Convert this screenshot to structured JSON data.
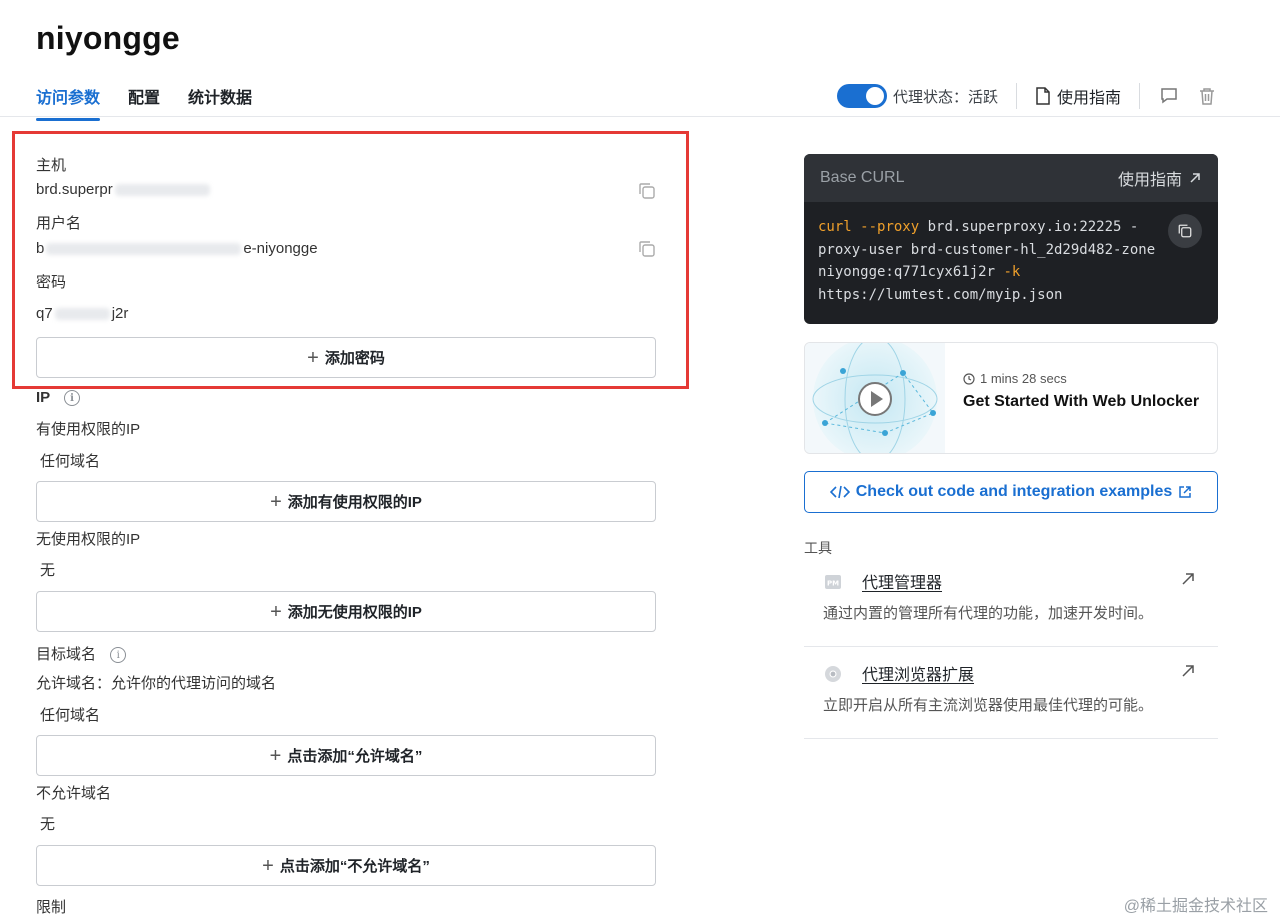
{
  "header": {
    "title": "niyongge",
    "tabs": [
      {
        "label": "访问参数",
        "active": true
      },
      {
        "label": "配置",
        "active": false
      },
      {
        "label": "统计数据",
        "active": false
      }
    ],
    "proxy_status_label": "代理状态：活跃",
    "guide_label": "使用指南",
    "accent_color": "#1a6fd1"
  },
  "credentials": {
    "host_label": "主机",
    "host_value_prefix": "brd.superpr",
    "username_label": "用户名",
    "username_value_prefix": "b",
    "username_value_suffix": "e-niyongge",
    "password_label": "密码",
    "password_value_prefix": "q7",
    "password_value_suffix": "j2r",
    "add_password_label": "添加密码"
  },
  "ip": {
    "section_label": "IP",
    "allowed_label": "有使用权限的IP",
    "allowed_value": "任何域名",
    "add_allowed_label": "添加有使用权限的IP",
    "denied_label": "无使用权限的IP",
    "denied_value": "无",
    "add_denied_label": "添加无使用权限的IP"
  },
  "domains": {
    "section_label": "目标域名",
    "allowed_label": "允许域名：允许你的代理访问的域名",
    "allowed_value": "任何域名",
    "add_allowed_label": "点击添加“允许域名”",
    "denied_label": "不允许域名",
    "denied_value": "无",
    "add_denied_label": "点击添加“不允许域名”"
  },
  "limits": {
    "section_label": "限制"
  },
  "curl": {
    "title": "Base CURL",
    "guide_label": "使用指南",
    "cmd": "curl",
    "proxy_flag": "--proxy",
    "line1_rest": " brd.superproxy.io:22225 -",
    "line1_trunc": "-",
    "line2": "proxy-user brd-customer-hl_2d29d482-zone",
    "line3_main": "niyongge:q771cyx61j2r ",
    "line3_flag": "-k",
    "line4": "https://lumtest.com/myip.json"
  },
  "video": {
    "duration": "1 mins 28 secs",
    "title": "Get Started With Web Unlocker"
  },
  "code_examples_label": "Check out code and integration examples",
  "tools": {
    "label": "工具",
    "items": [
      {
        "name": "代理管理器",
        "desc": "通过内置的管理所有代理的功能，加速开发时间。"
      },
      {
        "name": "代理浏览器扩展",
        "desc": "立即开启从所有主流浏览器使用最佳代理的可能。"
      }
    ]
  },
  "watermark": "@稀土掘金技术社区"
}
